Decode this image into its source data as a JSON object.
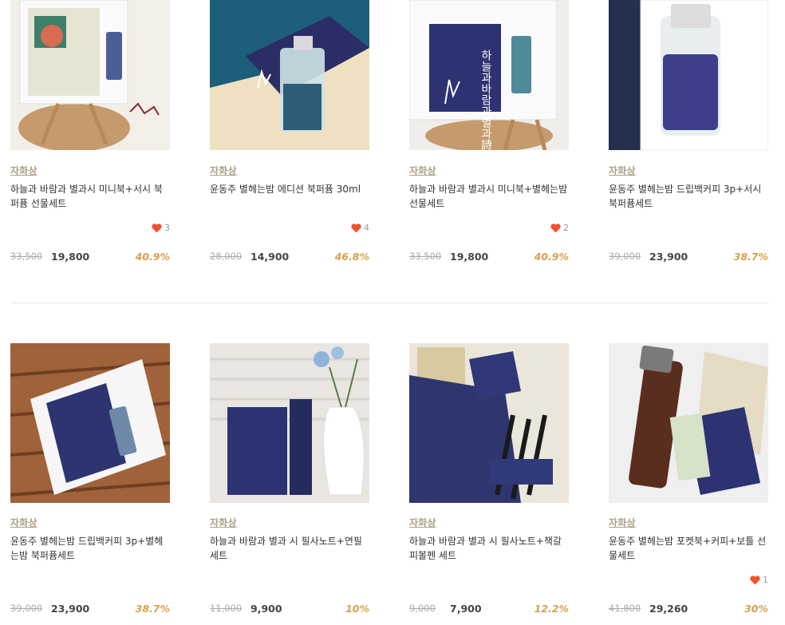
{
  "products": [
    {
      "brand": "자화상",
      "title": "하늘과 바람과 별과시 미니북+서시 북퍼퓸 선물세트",
      "likes": "3",
      "orig_price": "33,500",
      "sale_price": "19,800",
      "discount": "40.9%"
    },
    {
      "brand": "자화상",
      "title": "윤동주 별헤는밤 에디션 북퍼퓸 30ml",
      "likes": "4",
      "orig_price": "28,000",
      "sale_price": "14,900",
      "discount": "46.8%"
    },
    {
      "brand": "자화상",
      "title": "하늘과 바람과 별과시 미니북+별헤는밤 선물세트",
      "likes": "2",
      "orig_price": "33,500",
      "sale_price": "19,800",
      "discount": "40.9%"
    },
    {
      "brand": "자화상",
      "title": "윤동주 별헤는밤 드립백커피 3p+서시 북퍼퓸세트",
      "likes": "",
      "orig_price": "39,000",
      "sale_price": "23,900",
      "discount": "38.7%"
    },
    {
      "brand": "자화상",
      "title": "윤동주 별헤는밤 드립백커피 3p+별헤는밤 북퍼퓸세트",
      "likes": "",
      "orig_price": "39,000",
      "sale_price": "23,900",
      "discount": "38.7%"
    },
    {
      "brand": "자화상",
      "title": "하늘과 바람과 별과 시 필사노트+연필세트",
      "likes": "",
      "orig_price": "11,000",
      "sale_price": "9,900",
      "discount": "10%"
    },
    {
      "brand": "자화상",
      "title": "하늘과 바람과 별과 시 필사노트+책갈피볼펜 세트",
      "likes": "",
      "orig_price": "9,000",
      "sale_price": "7,900",
      "discount": "12.2%"
    },
    {
      "brand": "자화상",
      "title": "윤동주 별헤는밤 포켓북+커피+보틀 선물세트",
      "likes": "1",
      "orig_price": "41,800",
      "sale_price": "29,260",
      "discount": "30%"
    }
  ],
  "colors": {
    "accent_discount": "#d9a04e",
    "heart": "#f0522e",
    "brand_link": "#aaa088"
  },
  "book_cover_text": "하늘과바람과별과詩"
}
